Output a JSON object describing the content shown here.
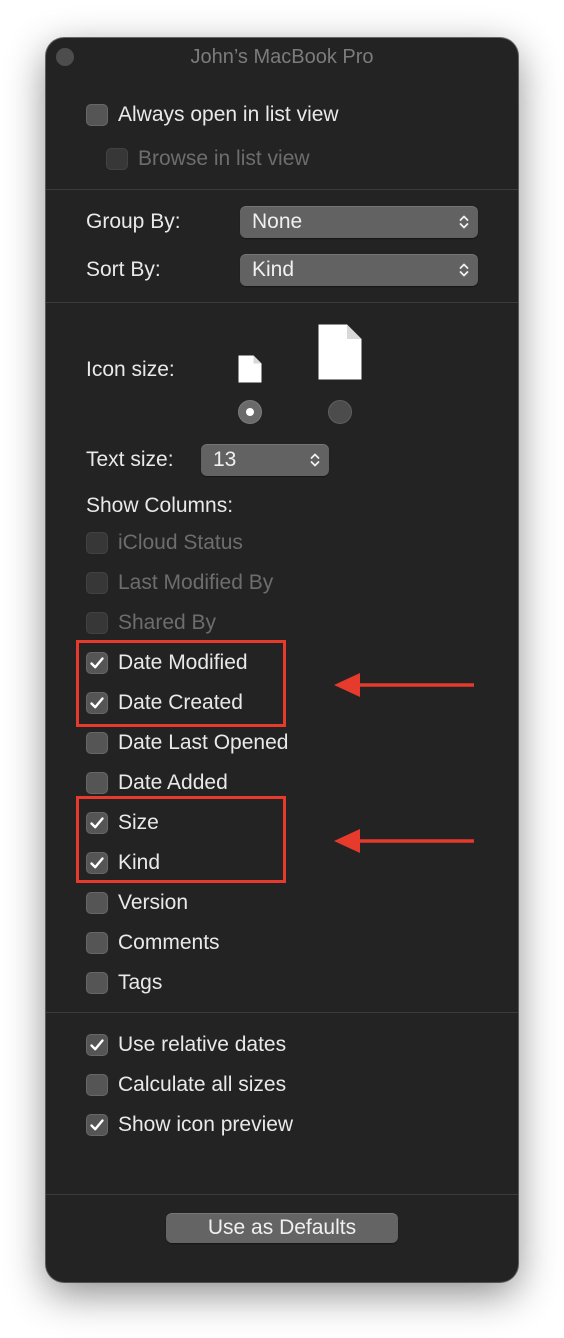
{
  "window": {
    "title": "John’s MacBook Pro"
  },
  "list_view": {
    "always_open": {
      "label": "Always open in list view",
      "checked": false,
      "enabled": true
    },
    "browse": {
      "label": "Browse in list view",
      "checked": false,
      "enabled": false
    }
  },
  "arrange": {
    "group_by": {
      "label": "Group By:",
      "value": "None"
    },
    "sort_by": {
      "label": "Sort By:",
      "value": "Kind"
    }
  },
  "icon_size": {
    "label": "Icon size:",
    "options": [
      "small",
      "large"
    ],
    "selected": "small"
  },
  "text_size": {
    "label": "Text size:",
    "value": "13"
  },
  "show_columns": {
    "heading": "Show Columns:",
    "items": [
      {
        "label": "iCloud Status",
        "checked": false,
        "enabled": false
      },
      {
        "label": "Last Modified By",
        "checked": false,
        "enabled": false
      },
      {
        "label": "Shared By",
        "checked": false,
        "enabled": false
      },
      {
        "label": "Date Modified",
        "checked": true,
        "enabled": true
      },
      {
        "label": "Date Created",
        "checked": true,
        "enabled": true
      },
      {
        "label": "Date Last Opened",
        "checked": false,
        "enabled": true
      },
      {
        "label": "Date Added",
        "checked": false,
        "enabled": true
      },
      {
        "label": "Size",
        "checked": true,
        "enabled": true
      },
      {
        "label": "Kind",
        "checked": true,
        "enabled": true
      },
      {
        "label": "Version",
        "checked": false,
        "enabled": true
      },
      {
        "label": "Comments",
        "checked": false,
        "enabled": true
      },
      {
        "label": "Tags",
        "checked": false,
        "enabled": true
      }
    ]
  },
  "options": {
    "items": [
      {
        "label": "Use relative dates",
        "checked": true,
        "enabled": true
      },
      {
        "label": "Calculate all sizes",
        "checked": false,
        "enabled": true
      },
      {
        "label": "Show icon preview",
        "checked": true,
        "enabled": true
      }
    ]
  },
  "footer": {
    "defaults_button": "Use as Defaults"
  },
  "colors": {
    "window_bg": "#232323",
    "annotation": "#e53a2c",
    "control": "#626262"
  },
  "icons": {
    "popup_chevron": "chevron-up-down-icon",
    "checkmark": "checkmark-icon",
    "document": "document-icon",
    "annotation_arrow": "left-arrow-icon"
  }
}
